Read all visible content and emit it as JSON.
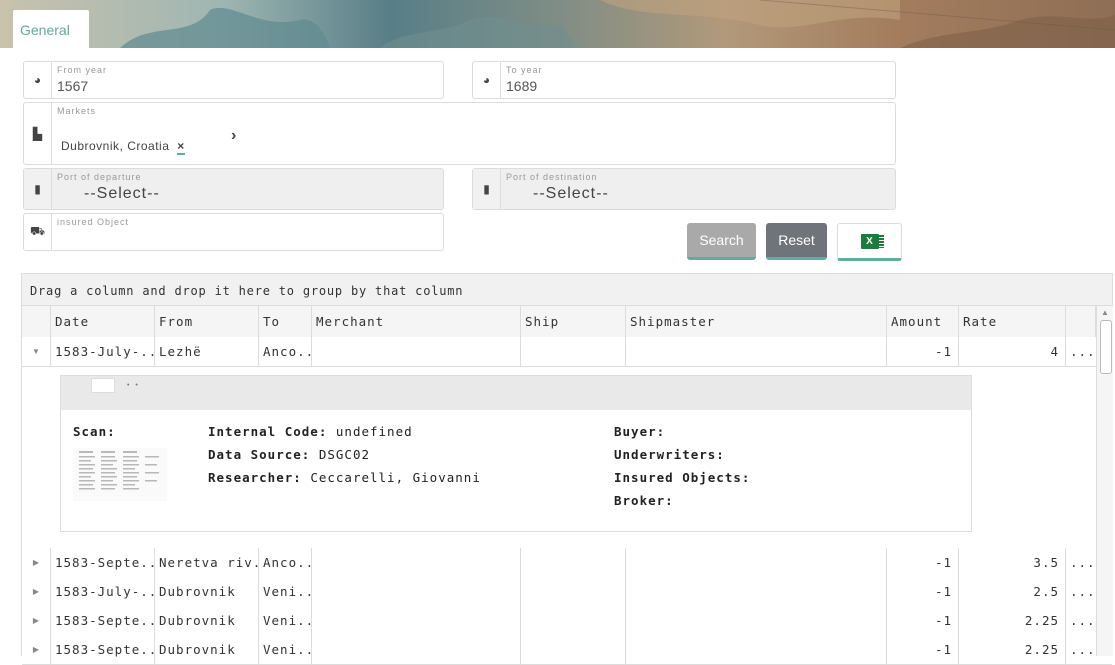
{
  "tabs": [
    {
      "label": "General",
      "active": true
    }
  ],
  "form": {
    "from_year": {
      "label": "From year",
      "value": "1567"
    },
    "to_year": {
      "label": "To year",
      "value": "1689"
    },
    "markets": {
      "label": "Markets",
      "selected": "Dubrovnik, Croatia",
      "remove_glyph": "×",
      "next_glyph": "›"
    },
    "port_departure": {
      "label": "Port of departure",
      "value": "--Select--"
    },
    "port_destination": {
      "label": "Port of destination",
      "value": "--Select--"
    },
    "insured_object": {
      "label": "insured Object",
      "value": ""
    }
  },
  "buttons": {
    "search": "Search",
    "reset": "Reset",
    "excel_glyph": "X"
  },
  "grid": {
    "group_hint": "Drag a column and drop it here to group by that column",
    "columns": [
      "Date",
      "From",
      "To",
      "Merchant",
      "Ship",
      "Shipmaster",
      "Amount",
      "Rate"
    ],
    "rows": [
      {
        "date": "1583-July-...",
        "from": "Lezhë",
        "to": "Anco...",
        "merchant": "",
        "ship": "",
        "shipmaster": "",
        "amount": "-1",
        "rate": "4",
        "more": "...",
        "expanded": true
      },
      {
        "date": "1583-Septe...",
        "from": "Neretva riv...",
        "to": "Anco...",
        "merchant": "",
        "ship": "",
        "shipmaster": "",
        "amount": "-1",
        "rate": "3.5",
        "more": "..."
      },
      {
        "date": "1583-July-...",
        "from": "Dubrovnik",
        "to": "Veni...",
        "merchant": "",
        "ship": "",
        "shipmaster": "",
        "amount": "-1",
        "rate": "2.5",
        "more": "..."
      },
      {
        "date": "1583-Septe...",
        "from": "Dubrovnik",
        "to": "Veni...",
        "merchant": "",
        "ship": "",
        "shipmaster": "",
        "amount": "-1",
        "rate": "2.25",
        "more": "..."
      },
      {
        "date": "1583-Septe...",
        "from": "Dubrovnik",
        "to": "Veni...",
        "merchant": "",
        "ship": "",
        "shipmaster": "",
        "amount": "-1",
        "rate": "2.25",
        "more": "..."
      }
    ],
    "detail": {
      "scan_label": "Scan:",
      "internal_code_label": "Internal Code:",
      "internal_code": "undefined",
      "data_source_label": "Data Source:",
      "data_source": "DSGC02",
      "researcher_label": "Researcher:",
      "researcher": "Ceccarelli, Giovanni",
      "buyer_label": "Buyer:",
      "underwriters_label": "Underwriters:",
      "insured_objects_label": "Insured Objects:",
      "broker_label": "Broker:"
    }
  },
  "colors": {
    "accent": "#5fae9d",
    "reset_button": "#6e747a",
    "search_button": "#a9a9a9",
    "excel": "#1f7a3e"
  }
}
